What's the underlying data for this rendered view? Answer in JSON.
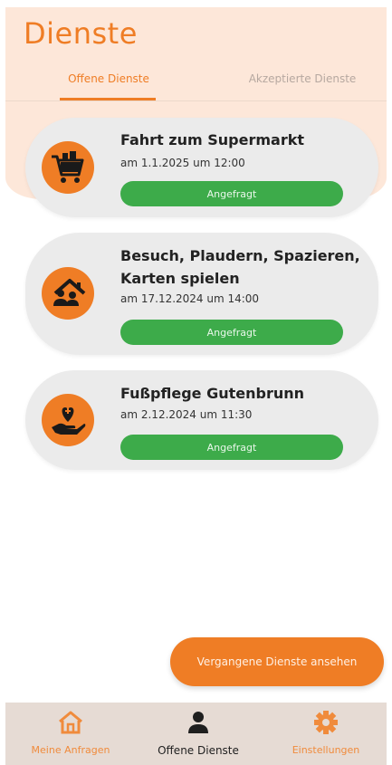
{
  "header": {
    "title": "Dienste",
    "tabs": {
      "open": "Offene Dienste",
      "accepted": "Akzeptierte Dienste"
    }
  },
  "services": [
    {
      "title": "Fahrt zum Supermarkt",
      "date": "am 1.1.2025 um 12:00",
      "status": "Angefragt",
      "icon": "shopping-cart-icon"
    },
    {
      "title": "Besuch, Plaudern, Spazieren, Karten spielen",
      "date": "am 17.12.2024 um 14:00",
      "status": "Angefragt",
      "icon": "family-home-icon"
    },
    {
      "title": "Fußpflege Gutenbrunn",
      "date": "am 2.12.2024 um 11:30",
      "status": "Angefragt",
      "icon": "caring-hand-heart-icon"
    }
  ],
  "past_button": "Vergangene Dienste ansehen",
  "nav": {
    "home": "Meine Anfragen",
    "offers": "Offene Dienste",
    "settings": "Einstellungen"
  },
  "colors": {
    "accent": "#ef7d25",
    "status_green": "#3dab4a",
    "header_bg": "#fde7d9",
    "card_bg": "#ebebeb"
  }
}
